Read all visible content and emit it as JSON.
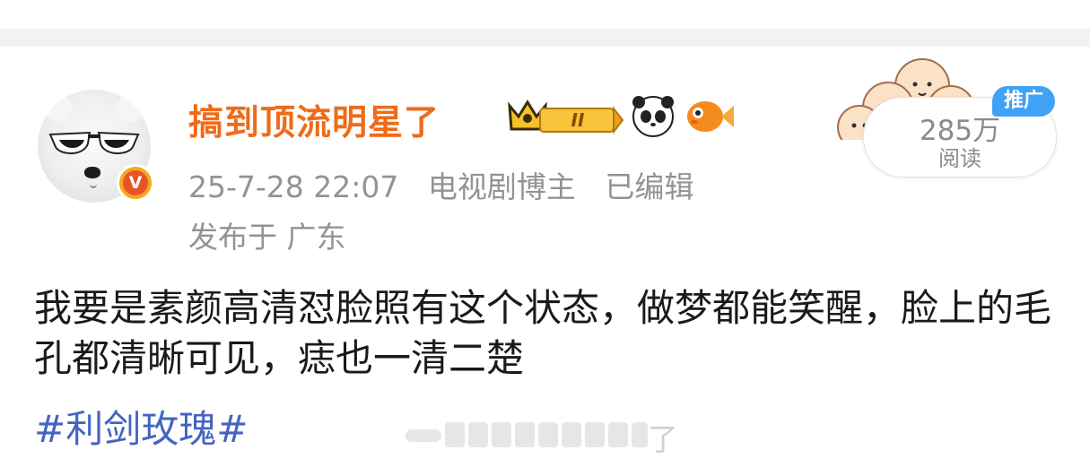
{
  "post": {
    "author": {
      "name": "搞到顶流明星了",
      "verified_badge": "V",
      "level_badge": "II",
      "badge_icons": [
        "crown-icon",
        "panda-icon",
        "goldfish-icon"
      ]
    },
    "meta": {
      "time": "25-7-28 22:07",
      "role": "电视剧博主",
      "edited": "已编辑",
      "location": "发布于 广东"
    },
    "text": "我要是素颜高清怼脸照有这个状态，做梦都能笑醒，脸上的毛孔都清晰可见，痣也一清二楚",
    "hashtag": "#利剑玫瑰#",
    "watermark_tail": "了"
  },
  "read_card": {
    "count": "285万",
    "label": "阅读",
    "promo_label": "推广"
  },
  "colors": {
    "username": "#f06b18",
    "meta": "#939393",
    "hashtag": "#4563c2",
    "promo": "#3fa2f5"
  }
}
